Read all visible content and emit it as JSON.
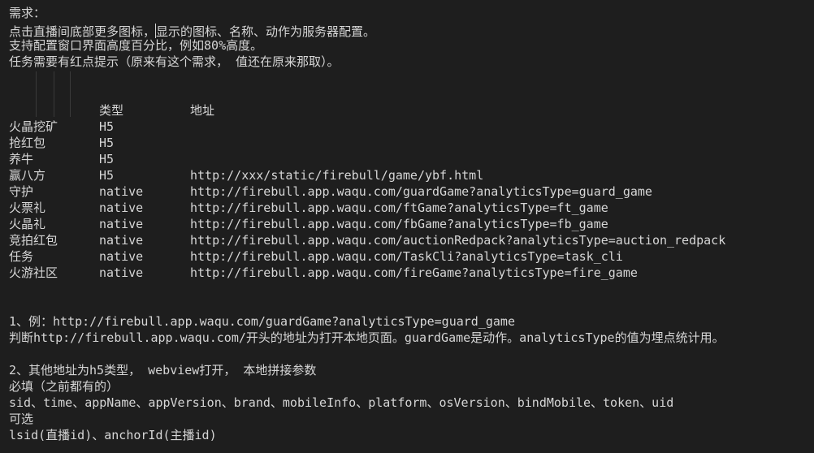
{
  "requirements": {
    "heading": "需求：",
    "line1_a": "点击直播间底部更多图标，",
    "line1_b": "显示的图标、名称、动作为服务器配置。",
    "line2": "支持配置窗口界面高度百分比，例如80%高度。",
    "line3": "任务需要有红点提示（原来有这个需求， 值还在原来那取）。"
  },
  "table": {
    "headers": {
      "type": "类型",
      "address": "地址"
    },
    "rows": [
      {
        "name": "火晶挖矿",
        "type": "H5",
        "url": ""
      },
      {
        "name": "抢红包",
        "type": "H5",
        "url": ""
      },
      {
        "name": "养牛",
        "type": "H5",
        "url": ""
      },
      {
        "name": "赢八方",
        "type": "H5",
        "url": "http://xxx/static/firebull/game/ybf.html"
      },
      {
        "name": "守护",
        "type": "native",
        "url": "http://firebull.app.waqu.com/guardGame?analyticsType=guard_game"
      },
      {
        "name": "火票礼",
        "type": "native",
        "url": "http://firebull.app.waqu.com/ftGame?analyticsType=ft_game"
      },
      {
        "name": "火晶礼",
        "type": "native",
        "url": "http://firebull.app.waqu.com/fbGame?analyticsType=fb_game"
      },
      {
        "name": "竞拍红包",
        "type": "native",
        "url": "http://firebull.app.waqu.com/auctionRedpack?analyticsType=auction_redpack"
      },
      {
        "name": "任务",
        "type": "native",
        "url": "http://firebull.app.waqu.com/TaskCli?analyticsType=task_cli"
      },
      {
        "name": "火游社区",
        "type": "native",
        "url": "http://firebull.app.waqu.com/fireGame?analyticsType=fire_game"
      }
    ]
  },
  "notes": {
    "example_line": "1、例：http://firebull.app.waqu.com/guardGame?analyticsType=guard_game",
    "rule_line": "判断http://firebull.app.waqu.com/开头的地址为打开本地页面。guardGame是动作。analyticsType的值为埋点统计用。",
    "other_line": "2、其他地址为h5类型， webview打开， 本地拼接参数",
    "required_label": "必填（之前都有的）",
    "required_params": "sid、time、appName、appVersion、brand、mobileInfo、platform、osVersion、bindMobile、token、uid",
    "optional_label": "可选",
    "optional_params": "lsid(直播id)、anchorId(主播id)"
  }
}
